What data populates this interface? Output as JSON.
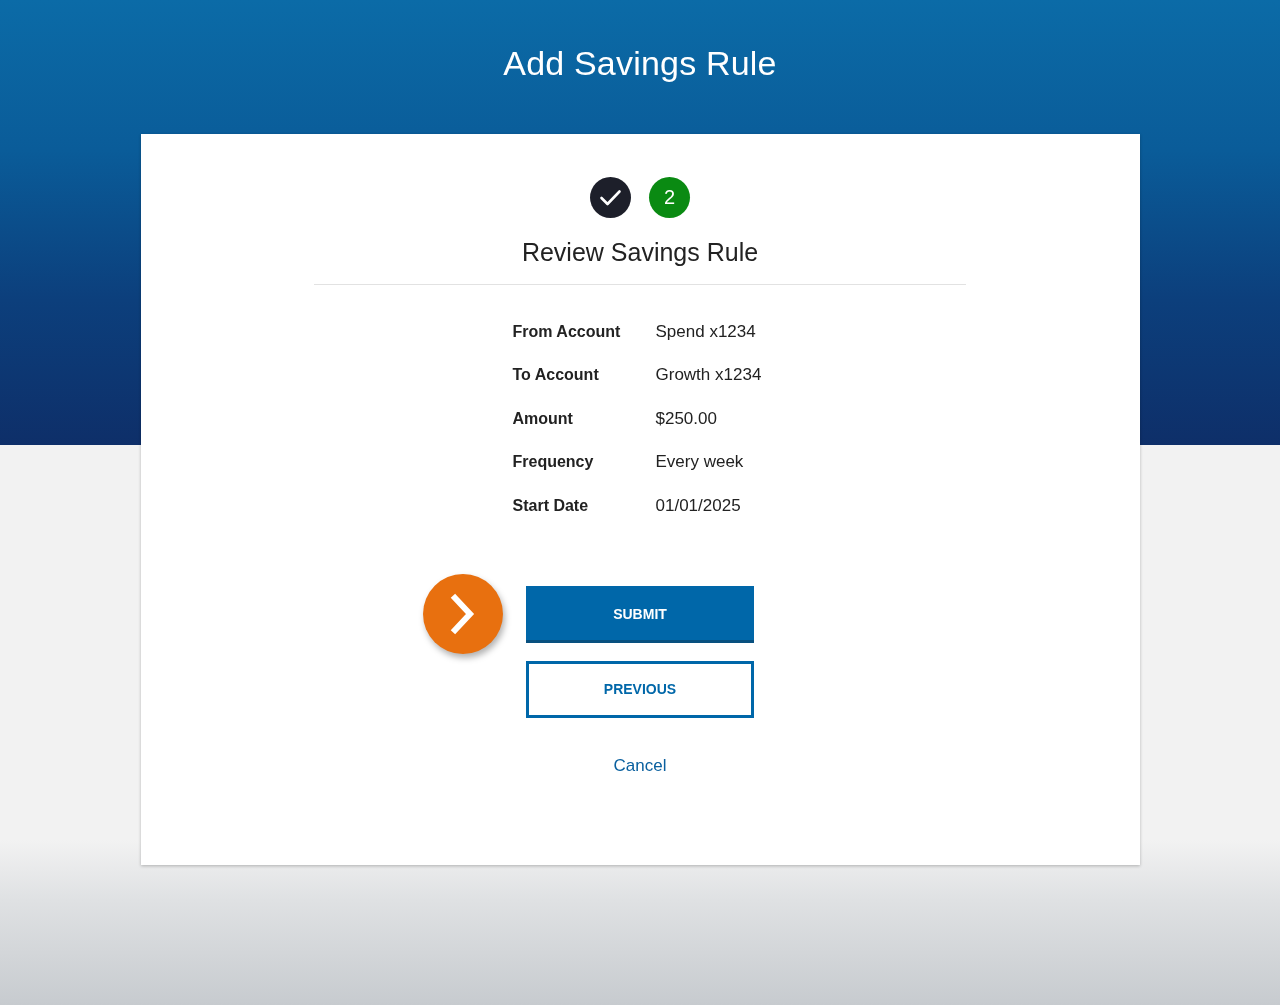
{
  "page": {
    "title": "Add Savings Rule"
  },
  "steps": [
    {
      "completed": true
    },
    {
      "completed": false,
      "label": "2"
    }
  ],
  "card": {
    "heading": "Review Savings Rule",
    "details": [
      {
        "label": "From Account",
        "value": "Spend x1234"
      },
      {
        "label": "To Account",
        "value": "Growth x1234"
      },
      {
        "label": "Amount",
        "value": "$250.00"
      },
      {
        "label": "Frequency",
        "value": "Every week"
      },
      {
        "label": "Start Date",
        "value": "01/01/2025"
      }
    ],
    "buttons": [
      {
        "label": "SUBMIT",
        "kind": "primary"
      },
      {
        "label": "PREVIOUS",
        "kind": "secondary"
      }
    ],
    "cancel_link": "Cancel"
  }
}
